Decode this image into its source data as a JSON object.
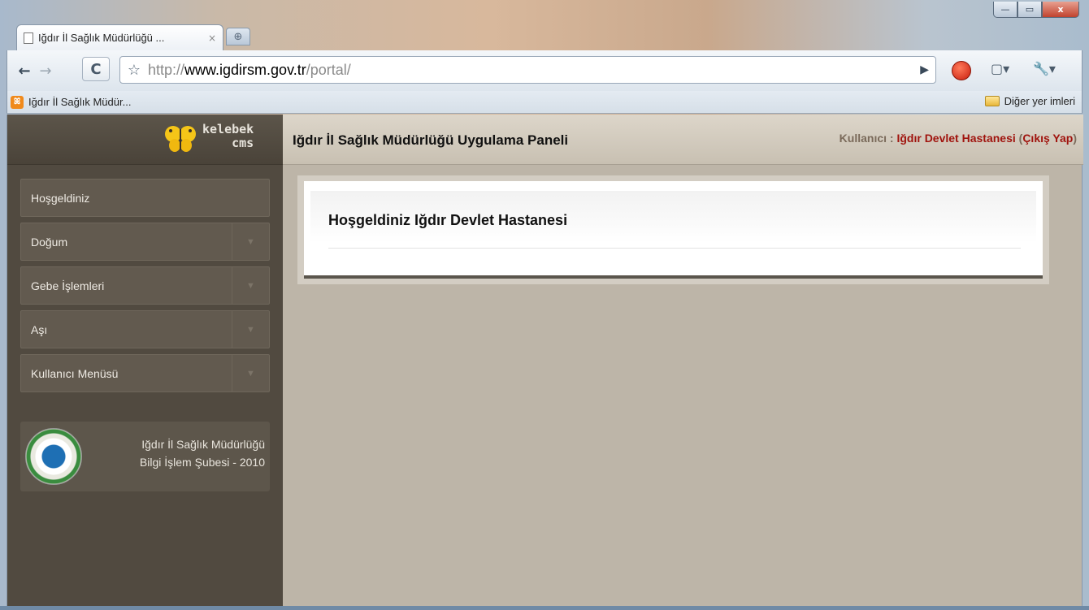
{
  "window": {
    "minimize_icon": "—",
    "maximize_icon": "▭",
    "close_icon": "x"
  },
  "tab": {
    "title": "Iğdır İl Sağlık Müdürlüğü ...",
    "close_glyph": "×",
    "new_tab_glyph": "⊕"
  },
  "toolbar": {
    "url_scheme": "http://",
    "url_host": "www.igdirsm.gov.tr",
    "url_path": "/portal/",
    "back_glyph": "←",
    "forward_glyph": "→",
    "reload_glyph": "C",
    "star_glyph": "☆",
    "go_glyph": "▶",
    "page_menu_glyph": "▢▾",
    "wrench_menu_glyph": "🔧▾"
  },
  "bookmarks": {
    "item": "Iğdır İl Sağlık Müdür...",
    "favicon_glyph": "ꕤ",
    "other": "Diğer yer imleri"
  },
  "sidebar": {
    "logo_line1": "kelebek",
    "logo_line2": "cms",
    "menu": [
      {
        "label": "Hoşgeldiniz",
        "has_dropdown": false
      },
      {
        "label": "Doğum",
        "has_dropdown": true
      },
      {
        "label": "Gebe İşlemleri",
        "has_dropdown": true
      },
      {
        "label": "Aşı",
        "has_dropdown": true
      },
      {
        "label": "Kullanıcı Menüsü",
        "has_dropdown": true
      }
    ],
    "chevron_glyph": "▼",
    "footer_line1": "Iğdır İl Sağlık Müdürlüğü",
    "footer_line2": "Bilgi İşlem Şubesi - 2010"
  },
  "header": {
    "title": "Iğdır İl Sağlık Müdürlüğü Uygulama Paneli",
    "user_label": "Kullanıcı : ",
    "user_name": "Iğdır Devlet Hastanesi",
    "logout_open": " (",
    "logout": "Çıkış Yap",
    "logout_close": ")"
  },
  "main": {
    "welcome": "Hoşgeldiniz Iğdır Devlet Hastanesi"
  },
  "colors": {
    "sidebar_bg": "#514a40",
    "content_bg": "#bdb5a8",
    "accent_red": "#a0140e"
  }
}
